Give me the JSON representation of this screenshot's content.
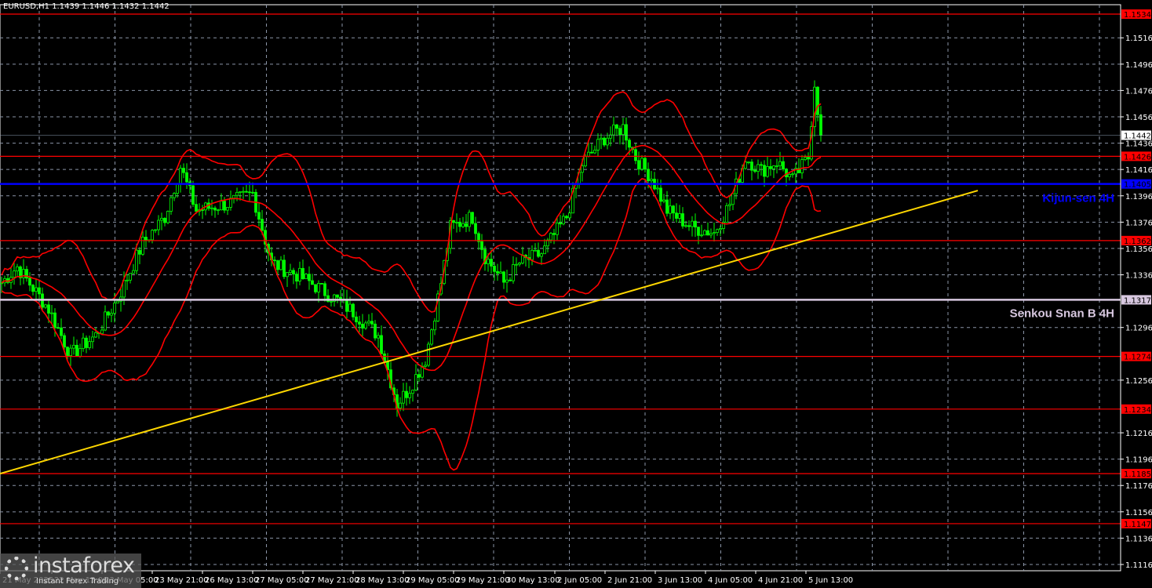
{
  "header": {
    "title": "EURUSD,H1  1.1439 1.1446 1.1432 1.1442"
  },
  "logo": {
    "name": "instaforex",
    "tagline": "Instant Forex Trading"
  },
  "chart_data": {
    "type": "candlestick",
    "symbol": "EURUSD",
    "timeframe": "H1",
    "ylim": [
      1.1106,
      1.1544
    ],
    "y_ticks": [
      "1.1516",
      "1.1496",
      "1.1476",
      "1.1456",
      "1.1436",
      "1.1416",
      "1.1396",
      "1.1376",
      "1.1356",
      "1.1336",
      "1.1296",
      "1.1256",
      "1.1216",
      "1.1196",
      "1.1176",
      "1.1156",
      "1.1136",
      "1.1116"
    ],
    "x_ticks": [
      "21 May 2025",
      "22 May 13:00",
      "23 May 05:00",
      "23 May 21:00",
      "26 May 13:00",
      "27 May 05:00",
      "27 May 21:00",
      "28 May 13:00",
      "29 May 05:00",
      "29 May 21:00",
      "30 May 13:00",
      "2 Jun 05:00",
      "2 Jun 21:00",
      "3 Jun 13:00",
      "4 Jun 05:00",
      "4 Jun 21:00",
      "5 Jun 13:00"
    ],
    "current_price": "1.1442",
    "levels": [
      {
        "price": "1.1534",
        "color": "#ff0000"
      },
      {
        "price": "1.1426",
        "color": "#ff0000"
      },
      {
        "price": "1.1362",
        "color": "#ff0000"
      },
      {
        "price": "1.1274",
        "color": "#ff0000"
      },
      {
        "price": "1.1234",
        "color": "#ff0000"
      },
      {
        "price": "1.1185",
        "color": "#ff0000"
      },
      {
        "price": "1.1147",
        "color": "#ff0000"
      }
    ],
    "kijun": {
      "price": "1.1405",
      "label": "Kijun-sen 4H",
      "color": "#0000ff"
    },
    "senkou": {
      "price": "1.1317",
      "label": "Senkou Snan B 4H",
      "color": "#d8c8e0"
    },
    "trendline": {
      "from": [
        0,
        1.1185
      ],
      "to": [
        311,
        1.14
      ],
      "color": "#ffd700"
    },
    "price_path": [
      [
        0,
        1.133
      ],
      [
        5,
        1.1342
      ],
      [
        15,
        1.131
      ],
      [
        22,
        1.1275
      ],
      [
        30,
        1.129
      ],
      [
        37,
        1.1318
      ],
      [
        45,
        1.136
      ],
      [
        52,
        1.138
      ],
      [
        57,
        1.1418
      ],
      [
        62,
        1.1385
      ],
      [
        72,
        1.139
      ],
      [
        80,
        1.1398
      ],
      [
        86,
        1.1345
      ],
      [
        95,
        1.1335
      ],
      [
        105,
        1.132
      ],
      [
        112,
        1.1308
      ],
      [
        120,
        1.129
      ],
      [
        126,
        1.1238
      ],
      [
        130,
        1.125
      ],
      [
        135,
        1.1272
      ],
      [
        140,
        1.133
      ],
      [
        143,
        1.1372
      ],
      [
        150,
        1.138
      ],
      [
        154,
        1.135
      ],
      [
        160,
        1.133
      ],
      [
        165,
        1.1345
      ],
      [
        172,
        1.1352
      ],
      [
        180,
        1.138
      ],
      [
        185,
        1.142
      ],
      [
        192,
        1.144
      ],
      [
        198,
        1.1448
      ],
      [
        202,
        1.1425
      ],
      [
        207,
        1.141
      ],
      [
        212,
        1.1385
      ],
      [
        220,
        1.1372
      ],
      [
        227,
        1.1368
      ],
      [
        232,
        1.139
      ],
      [
        237,
        1.1425
      ],
      [
        242,
        1.1415
      ],
      [
        247,
        1.1422
      ],
      [
        252,
        1.1408
      ],
      [
        257,
        1.1425
      ],
      [
        259,
        1.1482
      ],
      [
        261,
        1.1442
      ]
    ],
    "colors": {
      "candle": "#00ff00",
      "bands": "#ff0000",
      "grid": "#8a94a6"
    }
  }
}
